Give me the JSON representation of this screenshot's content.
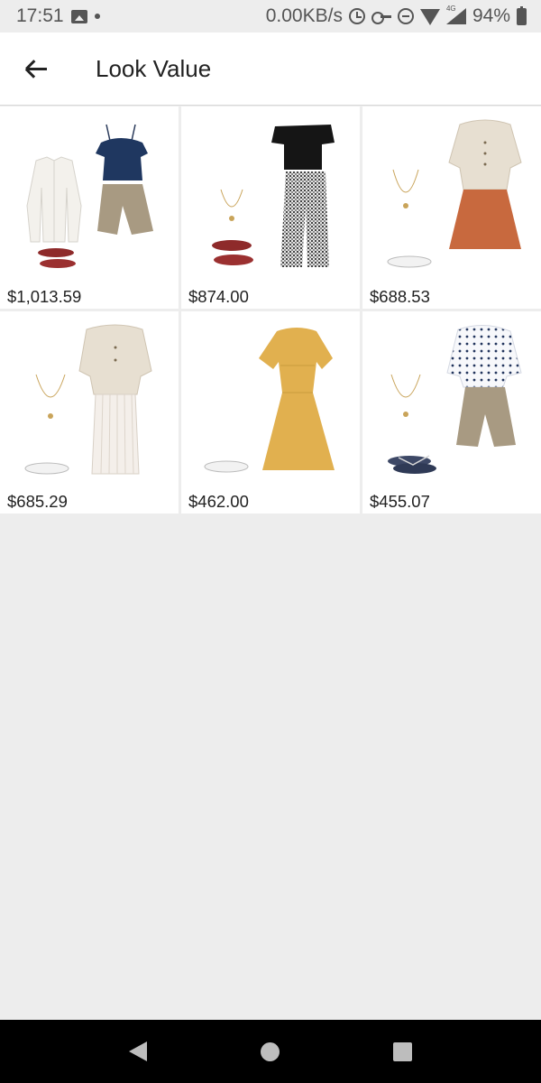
{
  "status_bar": {
    "time": "17:51",
    "network_speed": "0.00KB/s",
    "network_badge": "4G",
    "battery": "94%",
    "icons": [
      "image-icon",
      "dot-icon",
      "alarm-icon",
      "vpn-key-icon",
      "do-not-disturb-icon",
      "wifi-icon",
      "signal-icon",
      "battery-charging-icon"
    ]
  },
  "app_bar": {
    "back_icon": "arrow-left-icon",
    "title": "Look Value"
  },
  "looks": [
    {
      "price": "$1,013.59",
      "items": [
        "white-shirt",
        "navy-top",
        "khaki-shorts",
        "red-flats"
      ]
    },
    {
      "price": "$874.00",
      "items": [
        "black-top",
        "gingham-pants",
        "necklace",
        "red-flats"
      ]
    },
    {
      "price": "$688.53",
      "items": [
        "linen-top",
        "rust-skirt",
        "necklace",
        "white-flats"
      ]
    },
    {
      "price": "$685.29",
      "items": [
        "linen-top",
        "white-pleated-skirt",
        "necklace",
        "white-flats"
      ]
    },
    {
      "price": "$462.00",
      "items": [
        "mustard-dress",
        "white-flats"
      ]
    },
    {
      "price": "$455.07",
      "items": [
        "polka-dot-blouse",
        "khaki-shorts",
        "necklace",
        "navy-sandals"
      ]
    }
  ],
  "nav_bar": {
    "icons": [
      "nav-back-icon",
      "nav-home-icon",
      "nav-recents-icon"
    ]
  },
  "colors": {
    "background": "#ededed",
    "surface": "#ffffff",
    "text": "#222222",
    "nav_bar": "#000000"
  }
}
